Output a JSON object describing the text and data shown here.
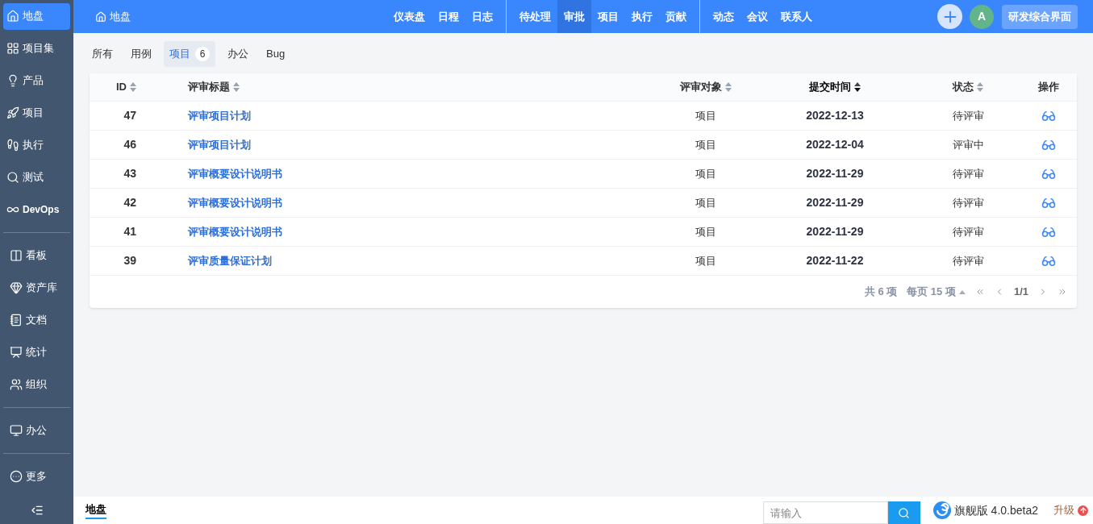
{
  "sidebar": {
    "groups": [
      [
        {
          "label": "地盘",
          "selected": true
        },
        {
          "label": "项目集",
          "selected": false
        },
        {
          "label": "产品",
          "selected": false
        },
        {
          "label": "项目",
          "selected": false
        },
        {
          "label": "执行",
          "selected": false
        },
        {
          "label": "测试",
          "selected": false
        },
        {
          "label": "DevOps",
          "selected": false
        }
      ],
      [
        {
          "label": "看板",
          "selected": false
        },
        {
          "label": "资产库",
          "selected": false
        },
        {
          "label": "文档",
          "selected": false
        },
        {
          "label": "统计",
          "selected": false
        },
        {
          "label": "组织",
          "selected": false
        }
      ],
      [
        {
          "label": "办公",
          "selected": false
        }
      ],
      [
        {
          "label": "更多",
          "selected": false
        }
      ]
    ]
  },
  "header": {
    "home": "地盘",
    "nav_groups": [
      [
        {
          "label": "仪表盘",
          "selected": false
        },
        {
          "label": "日程",
          "selected": false
        },
        {
          "label": "日志",
          "selected": false
        }
      ],
      [
        {
          "label": "待处理",
          "selected": false
        },
        {
          "label": "审批",
          "selected": true
        },
        {
          "label": "项目",
          "selected": false
        },
        {
          "label": "执行",
          "selected": false
        },
        {
          "label": "贡献",
          "selected": false
        }
      ],
      [
        {
          "label": "动态",
          "selected": false
        },
        {
          "label": "会议",
          "selected": false
        },
        {
          "label": "联系人",
          "selected": false
        }
      ]
    ],
    "avatar": "A",
    "interface_button": "研发综合界面"
  },
  "tabs": [
    {
      "label": "所有",
      "selected": false
    },
    {
      "label": "用例",
      "selected": false
    },
    {
      "label": "项目",
      "count": "6",
      "selected": true
    },
    {
      "label": "办公",
      "selected": false
    },
    {
      "label": "Bug",
      "selected": false
    }
  ],
  "table": {
    "columns": [
      {
        "label": "ID",
        "sorted": false
      },
      {
        "label": "评审标题",
        "sorted": false
      },
      {
        "label": "评审对象",
        "sorted": false
      },
      {
        "label": "提交时间",
        "sorted": true
      },
      {
        "label": "状态",
        "sorted": false
      },
      {
        "label": "操作"
      }
    ],
    "rows": [
      {
        "id": "47",
        "title": "评审项目计划",
        "object": "项目",
        "date": "2022-12-13",
        "status": "待评审"
      },
      {
        "id": "46",
        "title": "评审项目计划",
        "object": "项目",
        "date": "2022-12-04",
        "status": "评审中"
      },
      {
        "id": "43",
        "title": "评审概要设计说明书",
        "object": "项目",
        "date": "2022-11-29",
        "status": "待评审"
      },
      {
        "id": "42",
        "title": "评审概要设计说明书",
        "object": "项目",
        "date": "2022-11-29",
        "status": "待评审"
      },
      {
        "id": "41",
        "title": "评审概要设计说明书",
        "object": "项目",
        "date": "2022-11-29",
        "status": "待评审"
      },
      {
        "id": "39",
        "title": "评审质量保证计划",
        "object": "项目",
        "date": "2022-11-22",
        "status": "待评审"
      }
    ],
    "pager": {
      "total": "共 6 项",
      "per_page": "每页 15 项",
      "page": "1/1"
    }
  },
  "footer": {
    "breadcrumb": "地盘",
    "search_placeholder": "请输入",
    "version": "旗舰版 4.0.beta2",
    "upgrade": "升级"
  }
}
